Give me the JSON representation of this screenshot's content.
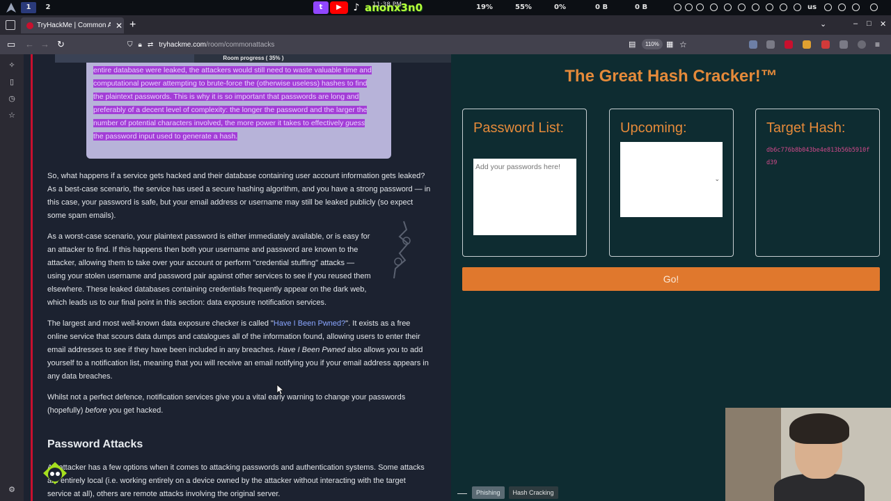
{
  "system_bar": {
    "workspace_1": "1",
    "workspace_2": "2",
    "clock_time": "11:38 PM",
    "stream_handle": "anonx3n0",
    "stat_cpu": "19%",
    "stat_mem": "55%",
    "stat_net": "0%",
    "stat_up": "0 B",
    "stat_down": "0 B",
    "keyboard_layout": "us"
  },
  "browser": {
    "tab_title": "TryHackMe | Common Att",
    "url_host": "tryhackme.com",
    "url_path": "/room/commonattacks",
    "zoom_level": "110%",
    "colors": {
      "tab_bg": "#42414d",
      "chrome_bg": "#2b2a33"
    }
  },
  "room": {
    "progress_label": "Room progress ( 35% )",
    "progress_percent": 35,
    "highlighted_lines": [
      "entire database were leaked, the attackers would still need to waste valuable time and",
      "computational power attempting to brute-force the (otherwise useless) hashes to find",
      "the plaintext passwords. This is why it is so important that passwords are long and",
      "preferably of a decent level of complexity: the longer the password and the larger the",
      "number of potential characters involved, the more power it takes to effectively ",
      "the password input used to generate a hash."
    ],
    "highlighted_italic": "guess",
    "para1": "So, what happens if a service gets hacked and their database containing user account information gets leaked? As a best-case scenario, the service has used a secure hashing algorithm, and you have a strong password — in this case, your password is safe, but your email address or username may still be leaked publicly (so expect some spam emails).",
    "para2": "As a worst-case scenario, your plaintext password is either immediately available, or is easy for an attacker to find. If this happens then both your username and password are known to the attacker, allowing them to take over your account or perform \"credential stuffing\" attacks — using your stolen username and password pair against other services to see if you reused them elsewhere. These leaked databases containing credentials frequently appear on the dark web, which leads us to our final point in this section: data exposure notification services.",
    "para3_a": "The largest and most well-known data exposure checker is called \"",
    "para3_link": "Have I Been Pwned?",
    "para3_b": "\". It exists as a free online service that scours data dumps and catalogues all of the information found, allowing users to enter their email addresses to see if they have been included in any breaches. ",
    "para3_italic": "Have I Been Pwned",
    "para3_c": " also allows you to add yourself to a notification list, meaning that you will receive an email notifying you if your email address appears in any data breaches.",
    "para4_a": "Whilst not a perfect defence, notification services give you a vital early warning to change your passwords (hopefully) ",
    "para4_italic": "before",
    "para4_b": " you get hacked.",
    "section_heading": "Password Attacks",
    "para5": "An attacker has a few options when it comes to attacking passwords and authentication systems. Some attacks are entirely local (i.e. working entirely on a device owned by the attacker without interacting with the target service at all), others are remote attacks involving the original server."
  },
  "hash_cracker": {
    "title": "The Great Hash Cracker!™",
    "password_list_heading": "Password List:",
    "password_placeholder": "Add your passwords here!",
    "upcoming_heading": "Upcoming:",
    "target_heading": "Target Hash:",
    "target_hash": "db6c776b8b043be4e813b56b5910fd39",
    "go_label": "Go!",
    "colors": {
      "accent": "#e58a3a",
      "bg": "#0e2c31",
      "hash": "#d14a8b",
      "button": "#e0782d"
    }
  },
  "bottom_tabs": {
    "tab_phishing": "Phishing",
    "tab_hash_cracking": "Hash Cracking"
  }
}
